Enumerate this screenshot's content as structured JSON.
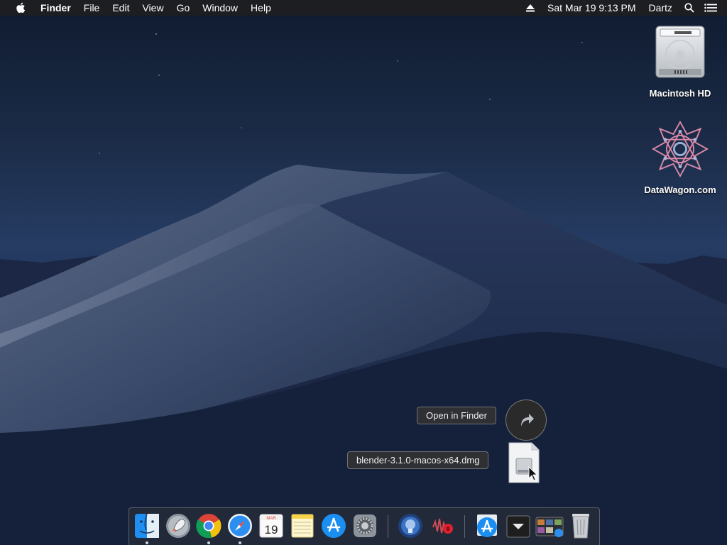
{
  "menubar": {
    "app_name": "Finder",
    "menus": [
      "File",
      "Edit",
      "View",
      "Go",
      "Window",
      "Help"
    ],
    "datetime": "Sat Mar 19  9:13 PM",
    "user": "Dartz"
  },
  "desktop": {
    "icons": [
      {
        "label": "Macintosh HD",
        "icon": "hard-drive-icon"
      },
      {
        "label": "DataWagon.com",
        "icon": "datawagon-logo-icon"
      }
    ]
  },
  "download": {
    "open_label": "Open in Finder",
    "filename": "blender-3.1.0-macos-x64.dmg"
  },
  "dock": {
    "calendar_month": "MAR",
    "calendar_day": "19",
    "apps": [
      "Finder",
      "Launchpad",
      "Chrome",
      "Safari",
      "Calendar",
      "Notes",
      "App Store",
      "System Preferences",
      "Proxyman",
      "Audio",
      "App Store Download",
      "Downloads",
      "Photos",
      "Trash"
    ]
  }
}
